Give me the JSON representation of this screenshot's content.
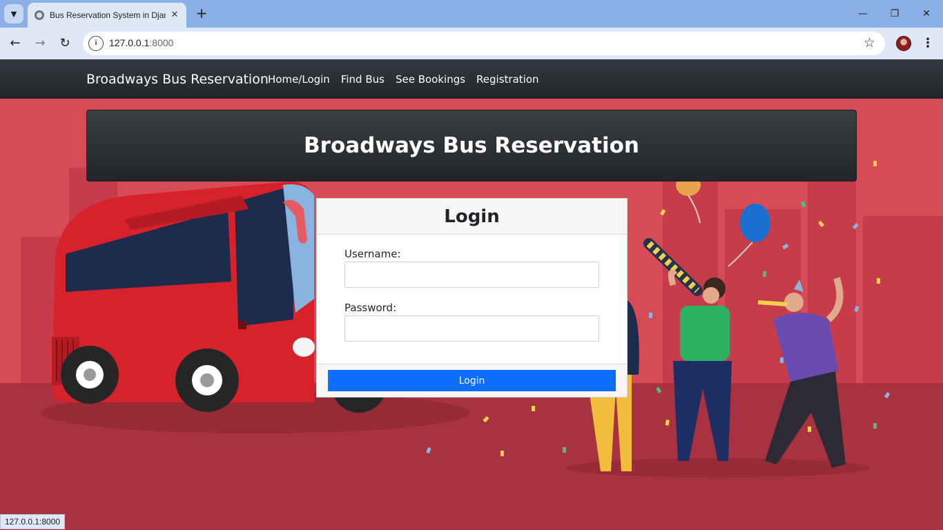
{
  "browser": {
    "tab_title": "Bus Reservation System in Djan",
    "url_host": "127.0.0.1",
    "url_port": ":8000",
    "status_url": "127.0.0.1:8000"
  },
  "site_nav": {
    "brand": "Broadways Bus Reservation",
    "links": [
      "Home/Login",
      "Find Bus",
      "See Bookings",
      "Registration"
    ]
  },
  "hero": {
    "title": "Broadways Bus Reservation"
  },
  "login": {
    "title": "Login",
    "username_label": "Username:",
    "username_value": "",
    "password_label": "Password:",
    "password_value": "",
    "submit_label": "Login"
  },
  "colors": {
    "scene_bg": "#d74b57",
    "ground": "#a8323f",
    "navbar": "#212529",
    "primary": "#0d6efd",
    "bus_red": "#d8222b"
  }
}
